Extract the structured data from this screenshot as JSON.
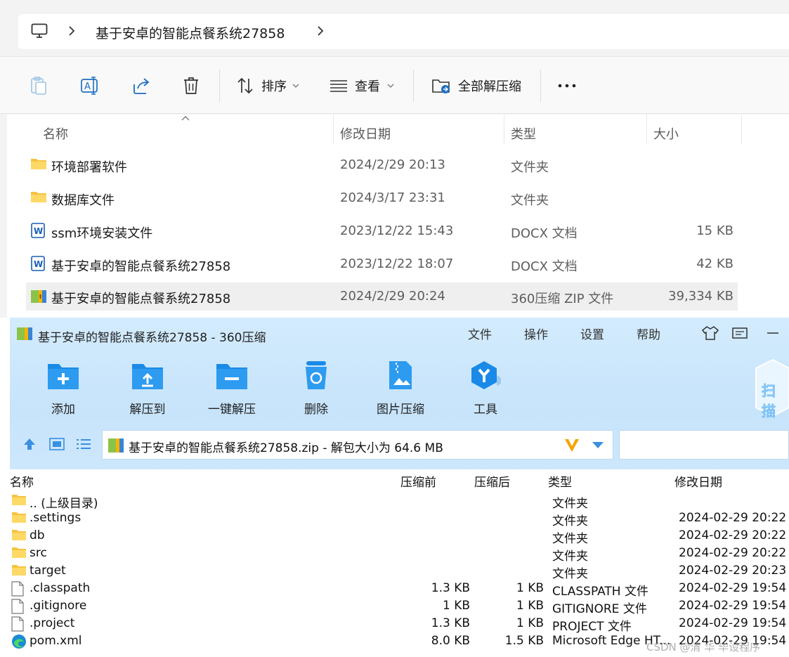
{
  "explorer": {
    "breadcrumb": {
      "folder": "基于安卓的智能点餐系统27858"
    },
    "commands": {
      "sort_label": "排序",
      "view_label": "查看",
      "extract_all_label": "全部解压缩"
    },
    "columns": {
      "name": "名称",
      "modified": "修改日期",
      "type": "类型",
      "size": "大小"
    },
    "files": [
      {
        "name": "环境部署软件",
        "modified": "2024/2/29 20:13",
        "type": "文件夹",
        "size": "",
        "icon": "folder-icon"
      },
      {
        "name": "数据库文件",
        "modified": "2024/3/17 23:31",
        "type": "文件夹",
        "size": "",
        "icon": "folder-icon"
      },
      {
        "name": "ssm环境安装文件",
        "modified": "2023/12/22 15:43",
        "type": "DOCX 文档",
        "size": "15 KB",
        "icon": "word-doc-icon"
      },
      {
        "name": "基于安卓的智能点餐系统27858",
        "modified": "2023/12/22 18:07",
        "type": "DOCX 文档",
        "size": "42 KB",
        "icon": "word-doc-icon"
      },
      {
        "name": "基于安卓的智能点餐系统27858",
        "modified": "2024/2/29 20:24",
        "type": "360压缩 ZIP 文件",
        "size": "39,334 KB",
        "icon": "zip-archive-icon",
        "selected": true
      }
    ]
  },
  "zip": {
    "title": "基于安卓的智能点餐系统27858 - 360压缩",
    "menu": [
      "文件",
      "操作",
      "设置",
      "帮助"
    ],
    "tools": [
      "添加",
      "解压到",
      "一键解压",
      "删除",
      "图片压缩",
      "工具"
    ],
    "scan_label": "扫描",
    "path": "基于安卓的智能点餐系统27858.zip - 解包大小为 64.6 MB",
    "columns": {
      "name": "名称",
      "before": "压缩前",
      "after": "压缩后",
      "type": "类型",
      "modified": "修改日期"
    },
    "rows": [
      {
        "name": ".. (上级目录)",
        "before": "",
        "after": "",
        "type": "文件夹",
        "modified": "",
        "icon": "folder-icon"
      },
      {
        "name": ".settings",
        "before": "",
        "after": "",
        "type": "文件夹",
        "modified": "2024-02-29 20:22",
        "icon": "folder-icon"
      },
      {
        "name": "db",
        "before": "",
        "after": "",
        "type": "文件夹",
        "modified": "2024-02-29 20:22",
        "icon": "folder-icon"
      },
      {
        "name": "src",
        "before": "",
        "after": "",
        "type": "文件夹",
        "modified": "2024-02-29 20:22",
        "icon": "folder-icon"
      },
      {
        "name": "target",
        "before": "",
        "after": "",
        "type": "文件夹",
        "modified": "2024-02-29 20:23",
        "icon": "folder-icon"
      },
      {
        "name": ".classpath",
        "before": "1.3 KB",
        "after": "1 KB",
        "type": "CLASSPATH 文件",
        "modified": "2024-02-29 19:54",
        "icon": "file-icon"
      },
      {
        "name": ".gitignore",
        "before": "1 KB",
        "after": "1 KB",
        "type": "GITIGNORE 文件",
        "modified": "2024-02-29 19:54",
        "icon": "file-icon"
      },
      {
        "name": ".project",
        "before": "1.3 KB",
        "after": "1 KB",
        "type": "PROJECT 文件",
        "modified": "2024-02-29 19:54",
        "icon": "file-icon"
      },
      {
        "name": "pom.xml",
        "before": "8.0 KB",
        "after": "1.5 KB",
        "type": "Microsoft Edge HT...",
        "modified": "2024-02-29 19:54",
        "icon": "edge-icon"
      }
    ],
    "watermark": "CSDN @清 华 毕设程序"
  }
}
